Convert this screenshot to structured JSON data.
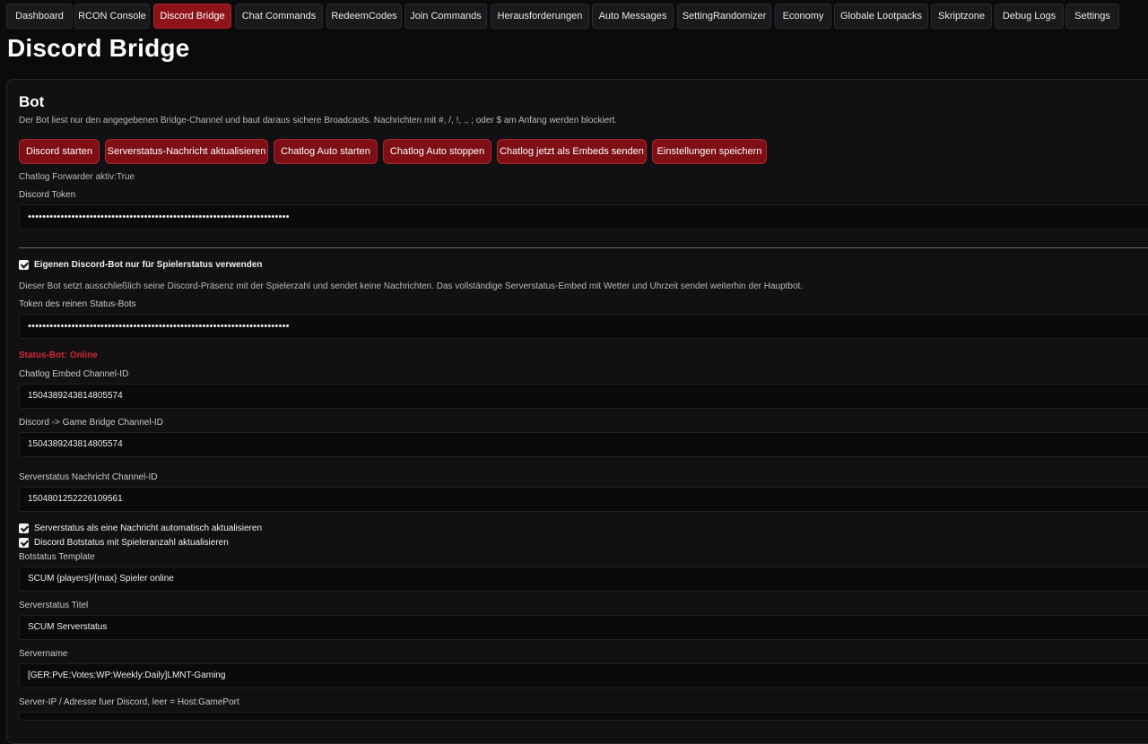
{
  "tabs": [
    {
      "label": "Dashboard",
      "active": false
    },
    {
      "label": "RCON Console",
      "active": false
    },
    {
      "label": "Discord Bridge",
      "active": true
    },
    {
      "label": "Chat Commands",
      "active": false
    },
    {
      "label": "RedeemCodes",
      "active": false
    },
    {
      "label": "Join Commands",
      "active": false
    },
    {
      "label": "Herausforderungen",
      "active": false
    },
    {
      "label": "Auto Messages",
      "active": false
    },
    {
      "label": "SettingRandomizer",
      "active": false
    },
    {
      "label": "Economy",
      "active": false
    },
    {
      "label": "Globale Lootpacks",
      "active": false
    },
    {
      "label": "Skriptzone",
      "active": false
    },
    {
      "label": "Debug Logs",
      "active": false
    },
    {
      "label": "Settings",
      "active": false
    }
  ],
  "page": {
    "title": "Discord Bridge"
  },
  "bot": {
    "title": "Bot",
    "description": "Der Bot liest nur den angegebenen Bridge-Channel und baut daraus sichere Broadcasts. Nachrichten mit #, /, !, ., ; oder $ am Anfang werden blockiert.",
    "buttons": [
      "Discord starten",
      "Serverstatus-Nachricht aktualisieren",
      "Chatlog Auto starten",
      "Chatlog Auto stoppen",
      "Chatlog jetzt als Embeds senden",
      "Einstellungen speichern"
    ],
    "forwarder_status": "Chatlog Forwarder aktiv:True",
    "discord_token": {
      "label": "Discord Token",
      "value": "••••••••••••••••••••••••••••••••••••••••••••••••••••••••••••••••••••••••"
    },
    "own_status_bot": {
      "checked": true,
      "label": "Eigenen Discord-Bot nur für Spielerstatus verwenden"
    },
    "status_bot_desc": "Dieser Bot setzt ausschließlich seine Discord-Präsenz mit der Spielerzahl und sendet keine Nachrichten. Das vollständige Serverstatus-Embed mit Wetter und Uhrzeit sendet weiterhin der Hauptbot.",
    "status_bot_token": {
      "label": "Token des reinen Status-Bots",
      "value": "••••••••••••••••••••••••••••••••••••••••••••••••••••••••••••••••••••••••"
    },
    "status_bot_state": "Status-Bot: Online",
    "chatlog_channel": {
      "label": "Chatlog Embed Channel-ID",
      "value": "1504389243814805574"
    },
    "bridge_channel": {
      "label": "Discord -> Game Bridge Channel-ID",
      "value": "1504389243814805574"
    },
    "serverstatus_channel": {
      "label": "Serverstatus Nachricht Channel-ID",
      "value": "1504801252226109561"
    },
    "auto_update_msg": {
      "checked": true,
      "label": "Serverstatus als eine Nachricht automatisch aktualisieren"
    },
    "update_botstatus": {
      "checked": true,
      "label": "Discord Botstatus mit Spieleranzahl aktualisieren"
    },
    "botstatus_template": {
      "label": "Botstatus Template",
      "value": "SCUM {players}/{max} Spieler online"
    },
    "serverstatus_title": {
      "label": "Serverstatus Titel",
      "value": "SCUM Serverstatus"
    },
    "servername": {
      "label": "Servername",
      "value": "[GER:PvE:Votes:WP:Weekly:Daily]LMNT-Gaming"
    },
    "server_ip": {
      "label": "Server-IP / Adresse fuer Discord, leer = Host:GamePort",
      "value": ""
    }
  },
  "colors": {
    "accent": "#8e1319",
    "status_online": "#d12a33",
    "background": "#0b0b0d"
  }
}
